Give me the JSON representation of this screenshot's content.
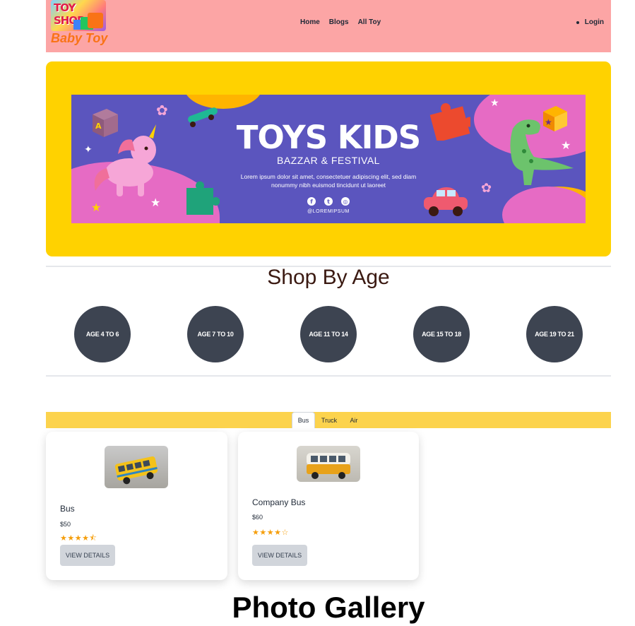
{
  "navbar": {
    "logo_text": "TOY SHOP",
    "brand_name": "Baby Toy",
    "links": [
      {
        "label": "Home"
      },
      {
        "label": "Blogs"
      },
      {
        "label": "All Toy"
      }
    ],
    "login_label": "Login",
    "bg_color": "#fca5a5"
  },
  "hero": {
    "bg_color": "#ffd200",
    "banner_title": "TOYS KIDS",
    "banner_subtitle": "BAZZAR & FESTIVAL",
    "banner_text": "Lorem ipsum dolor sit amet, consectetuer adipiscing elit, sed diam nonummy nibh euismod tincidunt ut laoreet",
    "banner_handle": "@LOREMIPSUM",
    "social_icons": [
      "facebook-icon",
      "twitter-icon",
      "instagram-icon"
    ]
  },
  "shop_by_age": {
    "title": "Shop By Age",
    "ages": [
      "AGE 4 TO 6",
      "AGE 7 TO 10",
      "AGE 11 TO 14",
      "AGE 15 TO 18",
      "AGE 19 TO 21"
    ]
  },
  "tabs": {
    "items": [
      {
        "label": "Bus",
        "active": true
      },
      {
        "label": "Truck",
        "active": false
      },
      {
        "label": "Air",
        "active": false
      }
    ]
  },
  "products": [
    {
      "name": "Bus",
      "price": "$50",
      "rating": 4.5,
      "stars": "★★★★⯪",
      "button": "View Details"
    },
    {
      "name": "Company Bus",
      "price": "$60",
      "rating": 4,
      "stars": "★★★★☆",
      "button": "View Details"
    }
  ],
  "gallery": {
    "title": "Photo Gallery"
  }
}
